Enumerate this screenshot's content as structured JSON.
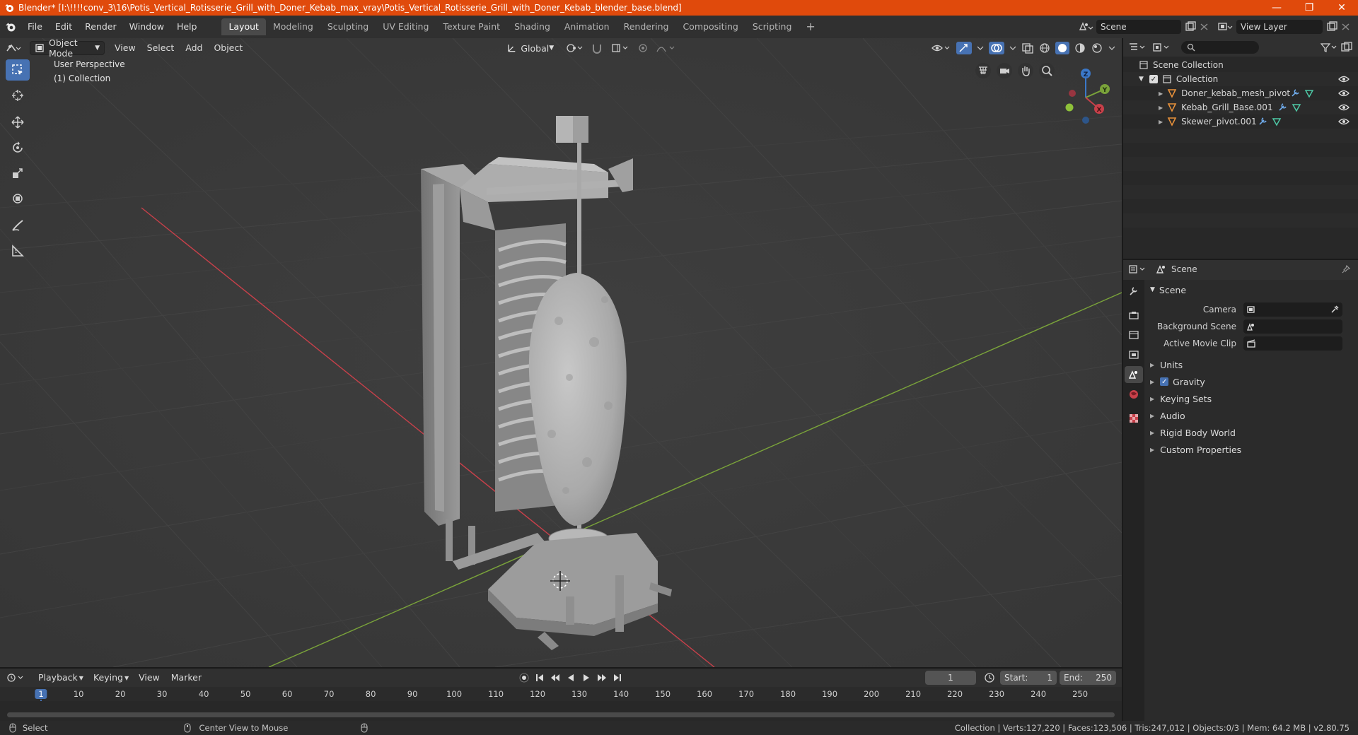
{
  "window": {
    "title": "Blender* [I:\\!!!!conv_3\\16\\Potis_Vertical_Rotisserie_Grill_with_Doner_Kebab_max_vray\\Potis_Vertical_Rotisserie_Grill_with_Doner_Kebab_blender_base.blend]",
    "minimize": "—",
    "maximize": "❐",
    "close": "✕"
  },
  "menu": [
    "File",
    "Edit",
    "Render",
    "Window",
    "Help"
  ],
  "workspaces": {
    "active": "Layout",
    "tabs": [
      "Layout",
      "Modeling",
      "Sculpting",
      "UV Editing",
      "Texture Paint",
      "Shading",
      "Animation",
      "Rendering",
      "Compositing",
      "Scripting"
    ],
    "add": "+"
  },
  "scene_selector": {
    "value": "Scene"
  },
  "view_layer_selector": {
    "value": "View Layer"
  },
  "viewport": {
    "mode": "Object Mode",
    "menus": [
      "View",
      "Select",
      "Add",
      "Object"
    ],
    "orientation": "Global",
    "info_line1": "User Perspective",
    "info_line2": "(1) Collection",
    "gizmo": {
      "z": "Z",
      "y": "Y",
      "x": "X"
    }
  },
  "outliner": {
    "search_placeholder": "",
    "rows": [
      {
        "label": "Scene Collection",
        "kind": "scene-collection"
      },
      {
        "label": "Collection",
        "kind": "collection"
      },
      {
        "label": "Doner_kebab_mesh_pivot",
        "kind": "object"
      },
      {
        "label": "Kebab_Grill_Base.001",
        "kind": "object"
      },
      {
        "label": "Skewer_pivot.001",
        "kind": "object"
      }
    ]
  },
  "properties": {
    "header": "Scene",
    "sections": {
      "scene": "Scene",
      "camera_label": "Camera",
      "background_scene_label": "Background Scene",
      "active_movie_clip_label": "Active Movie Clip",
      "units": "Units",
      "gravity": "Gravity",
      "keying_sets": "Keying Sets",
      "audio": "Audio",
      "rigid_body_world": "Rigid Body World",
      "custom_properties": "Custom Properties"
    },
    "gravity_checked": true
  },
  "timeline": {
    "menus": [
      "Playback",
      "Keying",
      "View",
      "Marker"
    ],
    "current_frame": "1",
    "start_label": "Start:",
    "start_value": "1",
    "end_label": "End:",
    "end_value": "250",
    "ruler": [
      "1",
      "10",
      "20",
      "30",
      "40",
      "50",
      "60",
      "70",
      "80",
      "90",
      "100",
      "110",
      "120",
      "130",
      "140",
      "150",
      "160",
      "170",
      "180",
      "190",
      "200",
      "210",
      "220",
      "230",
      "240",
      "250"
    ]
  },
  "statusbar": {
    "select": "Select",
    "center_view": "Center View to Mouse",
    "stats": "Collection | Verts:127,220 | Faces:123,506 | Tris:247,012 | Objects:0/3 | Mem: 64.2 MB | v2.80.75"
  },
  "colors": {
    "title_bar": "#e04a0c",
    "accent_blue": "#4772b3",
    "axis_x": "#c8404a",
    "axis_y": "#7aa33a",
    "axis_z": "#3b78c8"
  }
}
